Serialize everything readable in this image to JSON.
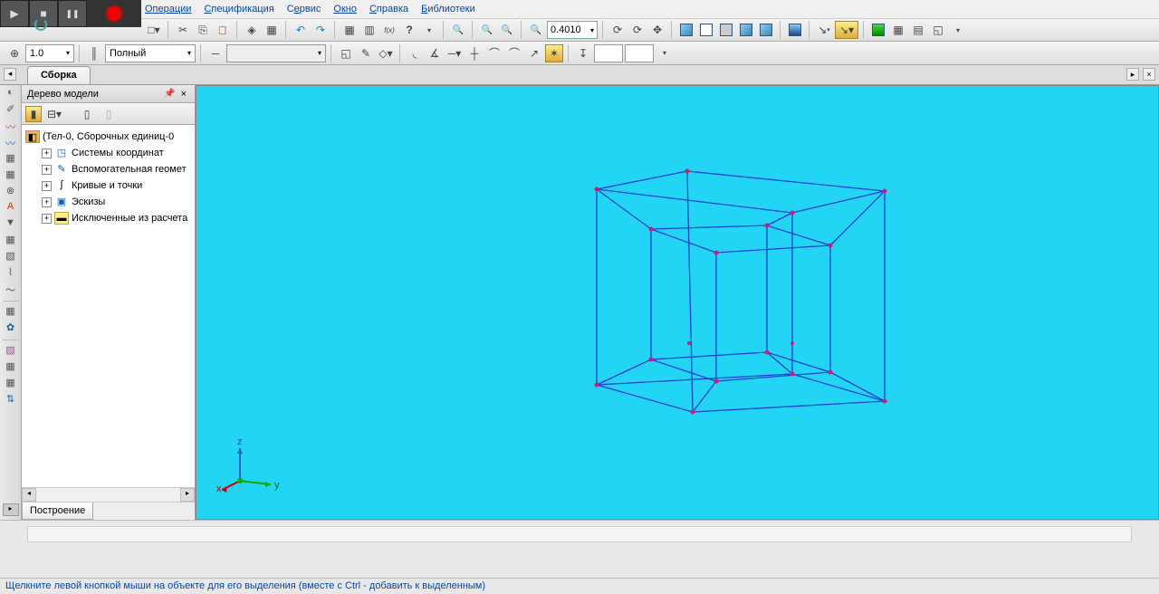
{
  "rec": {
    "state": "recording"
  },
  "menu": {
    "operations": "Операции",
    "specification": "Спецификация",
    "service": "Сервис",
    "window": "Окно",
    "help": "Справка",
    "libraries": "Библиотеки"
  },
  "toolbar": {
    "scale_value": "0.4010"
  },
  "toolbar2": {
    "step_value": "1.0",
    "style_value": "Полный"
  },
  "tabs": {
    "active": "Сборка"
  },
  "tree": {
    "title": "Дерево модели",
    "root": "(Тел-0, Сборочных единиц-0",
    "items": [
      "Системы координат",
      "Вспомогательная геомет",
      "Кривые и точки",
      "Эскизы",
      "Исключенные из расчета"
    ],
    "bottom_tab": "Построение"
  },
  "status": "Щелкните левой кнопкой мыши на объекте для его выделения (вместе с Ctrl - добавить к выделенным)",
  "viewport": {
    "axes": {
      "x": "x",
      "y": "y",
      "z": "z"
    }
  }
}
